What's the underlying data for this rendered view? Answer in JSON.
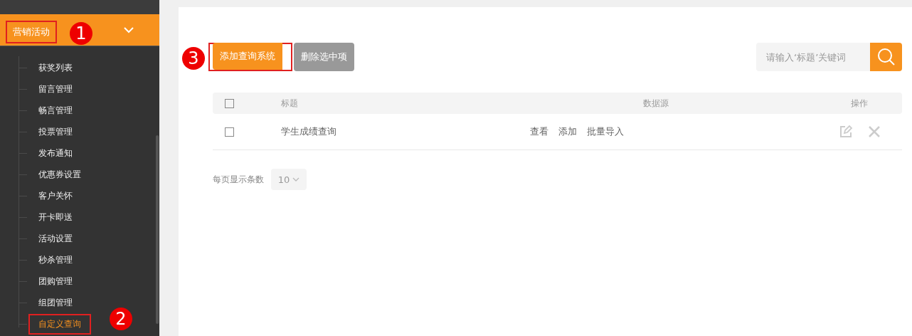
{
  "sidebar": {
    "menu": {
      "label": "营销活动",
      "expanded": true,
      "highlighted": true
    },
    "items": [
      {
        "label": "获奖列表",
        "selected": false
      },
      {
        "label": "留言管理",
        "selected": false
      },
      {
        "label": "畅言管理",
        "selected": false
      },
      {
        "label": "投票管理",
        "selected": false
      },
      {
        "label": "发布通知",
        "selected": false
      },
      {
        "label": "优惠券设置",
        "selected": false
      },
      {
        "label": "客户关怀",
        "selected": false
      },
      {
        "label": "开卡即送",
        "selected": false
      },
      {
        "label": "活动设置",
        "selected": false
      },
      {
        "label": "秒杀管理",
        "selected": false
      },
      {
        "label": "团购管理",
        "selected": false
      },
      {
        "label": "组团管理",
        "selected": false
      },
      {
        "label": "自定义查询",
        "selected": true
      }
    ]
  },
  "callouts": [
    "1",
    "2",
    "3"
  ],
  "toolbar": {
    "add_button": "添加查询系统",
    "delete_button": "删除选中项",
    "search": {
      "placeholder": "请输入‘标题’关键词"
    }
  },
  "table": {
    "select_all": {
      "checked": false
    },
    "columns": [
      "标题",
      "数据源",
      "操作"
    ],
    "rows": [
      {
        "checked": false,
        "title": "学生成绩查询",
        "links": [
          "查看",
          "添加",
          "批量导入"
        ]
      }
    ]
  },
  "pagination": {
    "label": "每页显示条数",
    "page_size": "10"
  }
}
